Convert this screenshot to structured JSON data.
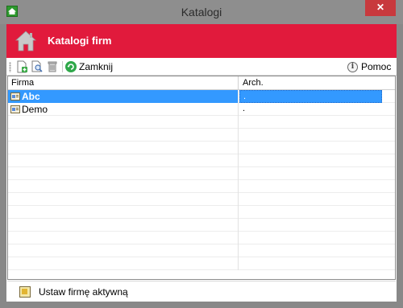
{
  "window": {
    "title": "Katalogi",
    "close_glyph": "✕"
  },
  "header": {
    "title": "Katalogi firm",
    "icon": "house-icon",
    "background_color": "#e11a3c"
  },
  "toolbar": {
    "add_icon": "add-document-icon",
    "preview_icon": "preview-icon",
    "delete_icon": "trash-icon",
    "close_label": "Zamknij",
    "help_label": "Pomoc",
    "help_glyph": "i"
  },
  "grid": {
    "columns": [
      "Firma",
      "Arch."
    ],
    "rows": [
      {
        "name": "Abc",
        "arch": ".",
        "selected": true
      },
      {
        "name": "Demo",
        "arch": ".",
        "selected": false
      }
    ],
    "selection_color": "#3399ff"
  },
  "footer": {
    "set_active_label": "Ustaw firmę aktywną"
  }
}
